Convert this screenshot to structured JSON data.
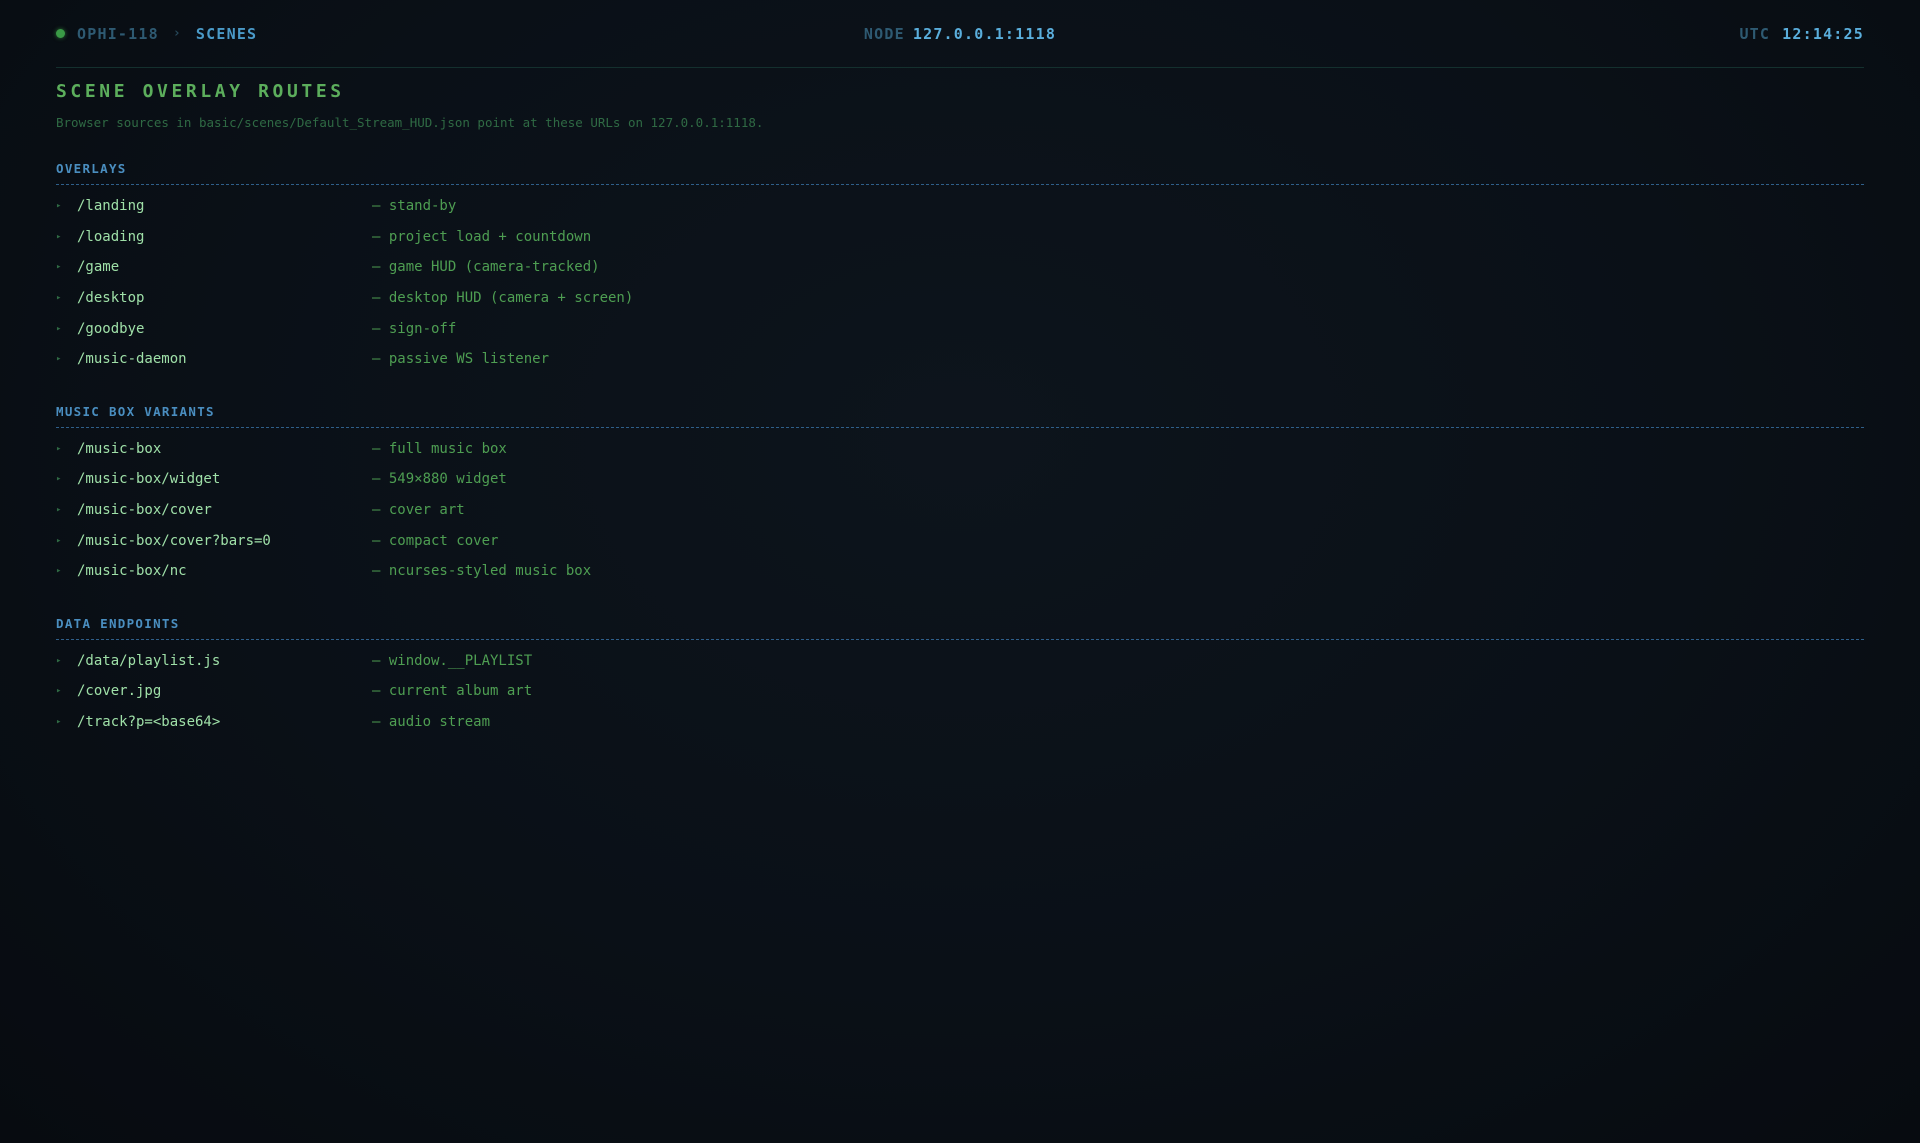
{
  "header": {
    "host": "OPHI-118",
    "separator": "›",
    "current": "SCENES",
    "node_label": "NODE",
    "node_value": "127.0.0.1:1118",
    "clock_label": "UTC",
    "clock_value": "12:14:25",
    "status_color": "#3a9a46"
  },
  "page": {
    "title": "SCENE OVERLAY ROUTES",
    "subtitle": "Browser sources in basic/scenes/Default_Stream_HUD.json point at these URLs on 127.0.0.1:1118."
  },
  "bullet": "▸",
  "sections": [
    {
      "title": "OVERLAYS",
      "routes": [
        {
          "path": "/landing",
          "desc": "— stand-by"
        },
        {
          "path": "/loading",
          "desc": "— project load + countdown"
        },
        {
          "path": "/game",
          "desc": "— game HUD (camera-tracked)"
        },
        {
          "path": "/desktop",
          "desc": "— desktop HUD (camera + screen)"
        },
        {
          "path": "/goodbye",
          "desc": "— sign-off"
        },
        {
          "path": "/music-daemon",
          "desc": "— passive WS listener"
        }
      ]
    },
    {
      "title": "MUSIC BOX VARIANTS",
      "routes": [
        {
          "path": "/music-box",
          "desc": "— full music box"
        },
        {
          "path": "/music-box/widget",
          "desc": "— 549×880 widget"
        },
        {
          "path": "/music-box/cover",
          "desc": "— cover art"
        },
        {
          "path": "/music-box/cover?bars=0",
          "desc": "— compact cover"
        },
        {
          "path": "/music-box/nc",
          "desc": "— ncurses-styled music box"
        }
      ]
    },
    {
      "title": "DATA ENDPOINTS",
      "routes": [
        {
          "path": "/data/playlist.js",
          "desc": "— window.__PLAYLIST"
        },
        {
          "path": "/cover.jpg",
          "desc": "— current album art"
        },
        {
          "path": "/track?p=<base64>",
          "desc": "— audio stream"
        }
      ]
    }
  ]
}
